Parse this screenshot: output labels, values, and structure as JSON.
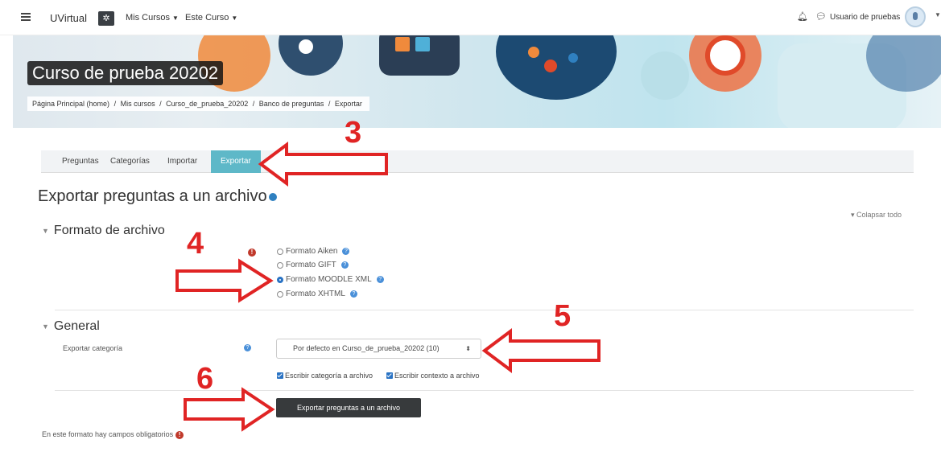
{
  "navbar": {
    "brand": "UVirtual",
    "menu_mis_cursos": "Mis Cursos",
    "menu_este_curso": "Este Curso",
    "user_name": "Usuario de pruebas"
  },
  "banner": {
    "course_title": "Curso de prueba 20202",
    "breadcrumb": [
      "Página Principal (home)",
      "/",
      "Mis cursos",
      "/",
      "Curso_de_prueba_20202",
      "/",
      "Banco de preguntas",
      "/",
      "Exportar"
    ]
  },
  "tabs": [
    {
      "label": "Preguntas",
      "active": false
    },
    {
      "label": "Categorías",
      "active": false
    },
    {
      "label": "Importar",
      "active": false
    },
    {
      "label": "Exportar",
      "active": true
    }
  ],
  "page": {
    "title": "Exportar preguntas a un archivo",
    "collapse_all": "Colapsar todo"
  },
  "format_section": {
    "title": "Formato de archivo",
    "options": [
      {
        "label": "Formato Aiken",
        "checked": false
      },
      {
        "label": "Formato GIFT",
        "checked": false
      },
      {
        "label": "Formato MOODLE XML",
        "checked": true
      },
      {
        "label": "Formato XHTML",
        "checked": false
      }
    ]
  },
  "general_section": {
    "title": "General",
    "category_label": "Exportar categoría",
    "category_value": "Por defecto en Curso_de_prueba_20202 (10)",
    "write_category": "Escribir categoría a archivo",
    "write_context": "Escribir contexto a archivo"
  },
  "submit_label": "Exportar preguntas a un archivo",
  "footnote": "En este formato hay campos obligatorios",
  "annotations": {
    "step3": "3",
    "step4": "4",
    "step5": "5",
    "step6": "6",
    "color": "#e02424"
  },
  "colors": {
    "active_tab": "#5eb8c8",
    "button": "#373a3c",
    "required": "#c0392b",
    "info": "#4a90d9"
  }
}
